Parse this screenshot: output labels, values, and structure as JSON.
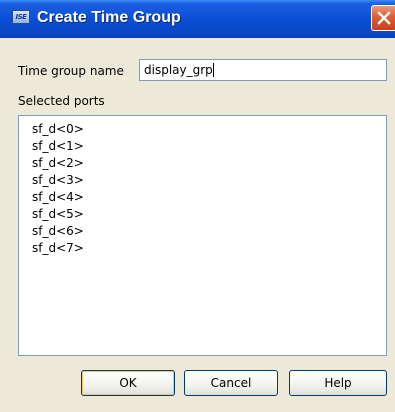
{
  "window": {
    "title": "Create Time Group",
    "icon_text": "ISE"
  },
  "form": {
    "time_group_name_label": "Time group name",
    "time_group_name_value": "display_grp",
    "selected_ports_label": "Selected ports",
    "ports": [
      "sf_d<0>",
      "sf_d<1>",
      "sf_d<2>",
      "sf_d<3>",
      "sf_d<4>",
      "sf_d<5>",
      "sf_d<6>",
      "sf_d<7>"
    ]
  },
  "buttons": {
    "ok": "OK",
    "cancel": "Cancel",
    "help": "Help"
  },
  "colors": {
    "titlebar": "#0a4fd6",
    "dialog_background": "#ece9d8",
    "close_button": "#e0603a",
    "input_border": "#7f9db9"
  },
  "icons": {
    "app": "ise-app-icon",
    "close": "close-icon"
  }
}
